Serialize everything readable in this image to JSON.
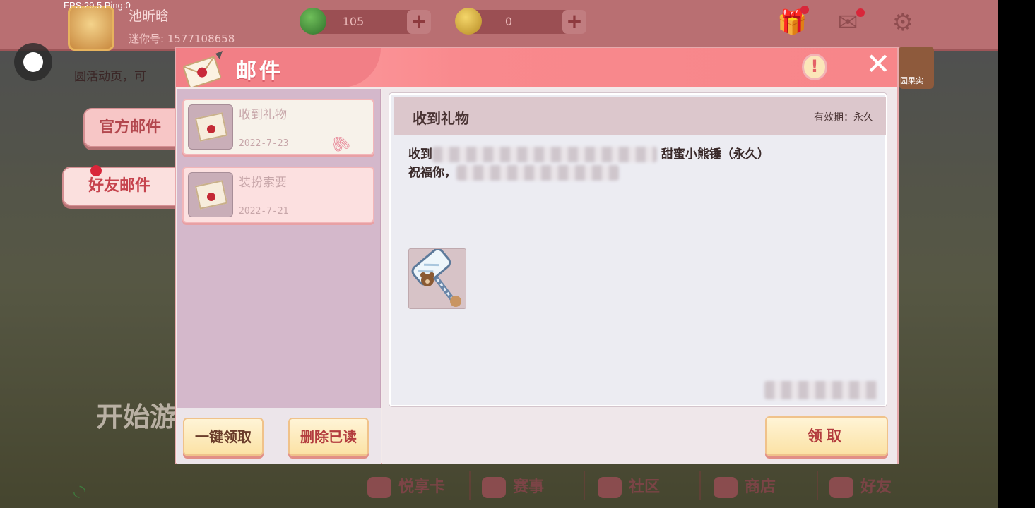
{
  "overlay": {
    "fps": "FPS:29.5  Ping:0"
  },
  "player": {
    "name": "池昕晗",
    "id_label": "迷你号: 1577108658"
  },
  "currencies": [
    {
      "name": "gem",
      "value": "105",
      "color": "#3f8a3a"
    },
    {
      "name": "coin",
      "value": "0",
      "color": "#d9b23a"
    }
  ],
  "home": {
    "news": "圆活动页，可",
    "start_button": "开始游",
    "right_banner": "园果实"
  },
  "side_tabs": {
    "official": "官方邮件",
    "friend": "好友邮件"
  },
  "dialog": {
    "title": "邮件",
    "alert_icon": "!",
    "close_icon": "✕",
    "mails": [
      {
        "subject": "收到礼物",
        "date": "2022-7-23",
        "selected": true,
        "has_attachment": true
      },
      {
        "subject": "装扮索要",
        "date": "2022-7-21",
        "selected": false,
        "has_attachment": false
      }
    ],
    "buttons": {
      "claim_all": "一键领取",
      "delete_read": "删除已读",
      "claim": "领取"
    },
    "detail": {
      "title": "收到礼物",
      "expiry": "有效期：永久",
      "line1_prefix": "收到",
      "line1_suffix": "甜蜜小熊锤（永久）",
      "line2_prefix": "祝福你，"
    }
  },
  "bottom_nav": {
    "items": [
      {
        "key": "card",
        "label": "悦享卡"
      },
      {
        "key": "event",
        "label": "赛事"
      },
      {
        "key": "community",
        "label": "社区"
      },
      {
        "key": "shop",
        "label": "商店"
      },
      {
        "key": "friend",
        "label": "好友"
      }
    ]
  },
  "colors": {
    "header_pink": "#f9898d",
    "accent_red": "#d9263a",
    "button_gold": "#fbe2a5"
  }
}
